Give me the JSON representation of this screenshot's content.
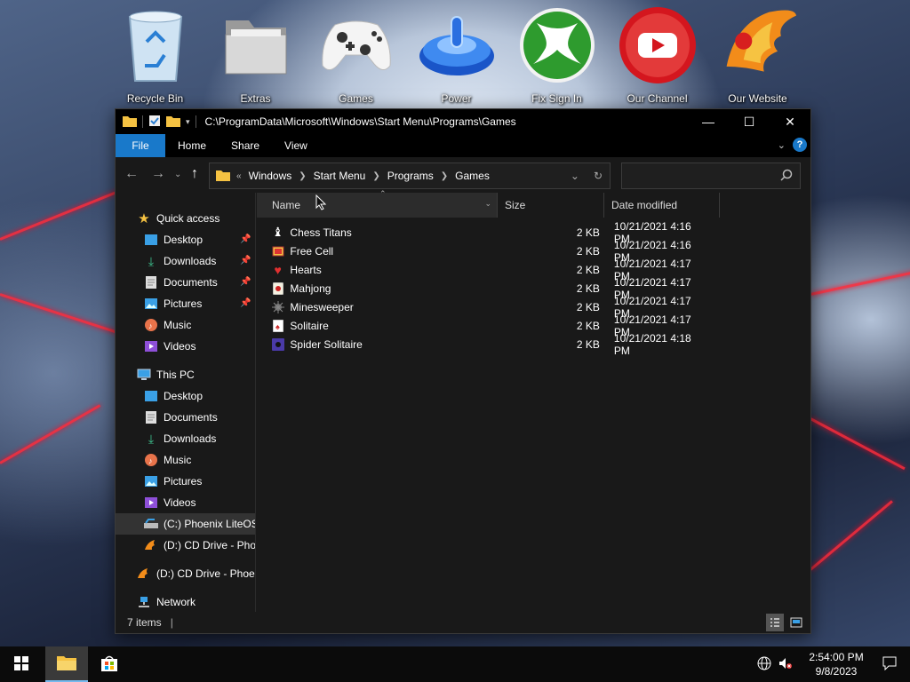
{
  "desktop": {
    "icons": [
      {
        "label": "Recycle Bin",
        "icon": "recycle-bin-icon"
      },
      {
        "label": "Extras",
        "icon": "folder-icon"
      },
      {
        "label": "Games",
        "icon": "gamepad-icon"
      },
      {
        "label": "Power",
        "icon": "power-icon"
      },
      {
        "label": "Fix Sign In",
        "icon": "xbox-icon"
      },
      {
        "label": "Our Channel",
        "icon": "youtube-icon"
      },
      {
        "label": "Our Website",
        "icon": "phoenix-icon"
      }
    ]
  },
  "window": {
    "title_path": "C:\\ProgramData\\Microsoft\\Windows\\Start Menu\\Programs\\Games",
    "caption": {
      "minimize": "—",
      "maximize": "☐",
      "close": "✕"
    },
    "ribbon_tabs": [
      "File",
      "Home",
      "Share",
      "View"
    ],
    "help_label": "?",
    "breadcrumb": {
      "overflow": "«",
      "items": [
        "Windows",
        "Start Menu",
        "Programs",
        "Games"
      ]
    },
    "search": {
      "placeholder": ""
    },
    "nav": {
      "quick_access": "Quick access",
      "quick_items": [
        "Desktop",
        "Downloads",
        "Documents",
        "Pictures",
        "Music",
        "Videos"
      ],
      "this_pc": "This PC",
      "pc_items": [
        "Desktop",
        "Documents",
        "Downloads",
        "Music",
        "Pictures",
        "Videos",
        "(C:) Phoenix LiteOS",
        "(D:) CD Drive - Phoe"
      ],
      "cd_drive": "(D:) CD Drive - Phoer",
      "network": "Network"
    },
    "columns": {
      "name": "Name",
      "size": "Size",
      "date": "Date modified"
    },
    "files": [
      {
        "name": "Chess Titans",
        "size": "2 KB",
        "date": "10/21/2021 4:16 PM"
      },
      {
        "name": "Free Cell",
        "size": "2 KB",
        "date": "10/21/2021 4:16 PM"
      },
      {
        "name": "Hearts",
        "size": "2 KB",
        "date": "10/21/2021 4:17 PM"
      },
      {
        "name": "Mahjong",
        "size": "2 KB",
        "date": "10/21/2021 4:17 PM"
      },
      {
        "name": "Minesweeper",
        "size": "2 KB",
        "date": "10/21/2021 4:17 PM"
      },
      {
        "name": "Solitaire",
        "size": "2 KB",
        "date": "10/21/2021 4:17 PM"
      },
      {
        "name": "Spider Solitaire",
        "size": "2 KB",
        "date": "10/21/2021 4:18 PM"
      }
    ],
    "status": {
      "count": "7 items",
      "divider": "|"
    }
  },
  "taskbar": {
    "clock_time": "2:54:00 PM",
    "clock_date": "9/8/2023"
  },
  "colors": {
    "accent": "#1979ca",
    "window_bg": "#191919",
    "taskbar_bg": "#0b0b0b",
    "folder_yellow": "#f5c242"
  }
}
